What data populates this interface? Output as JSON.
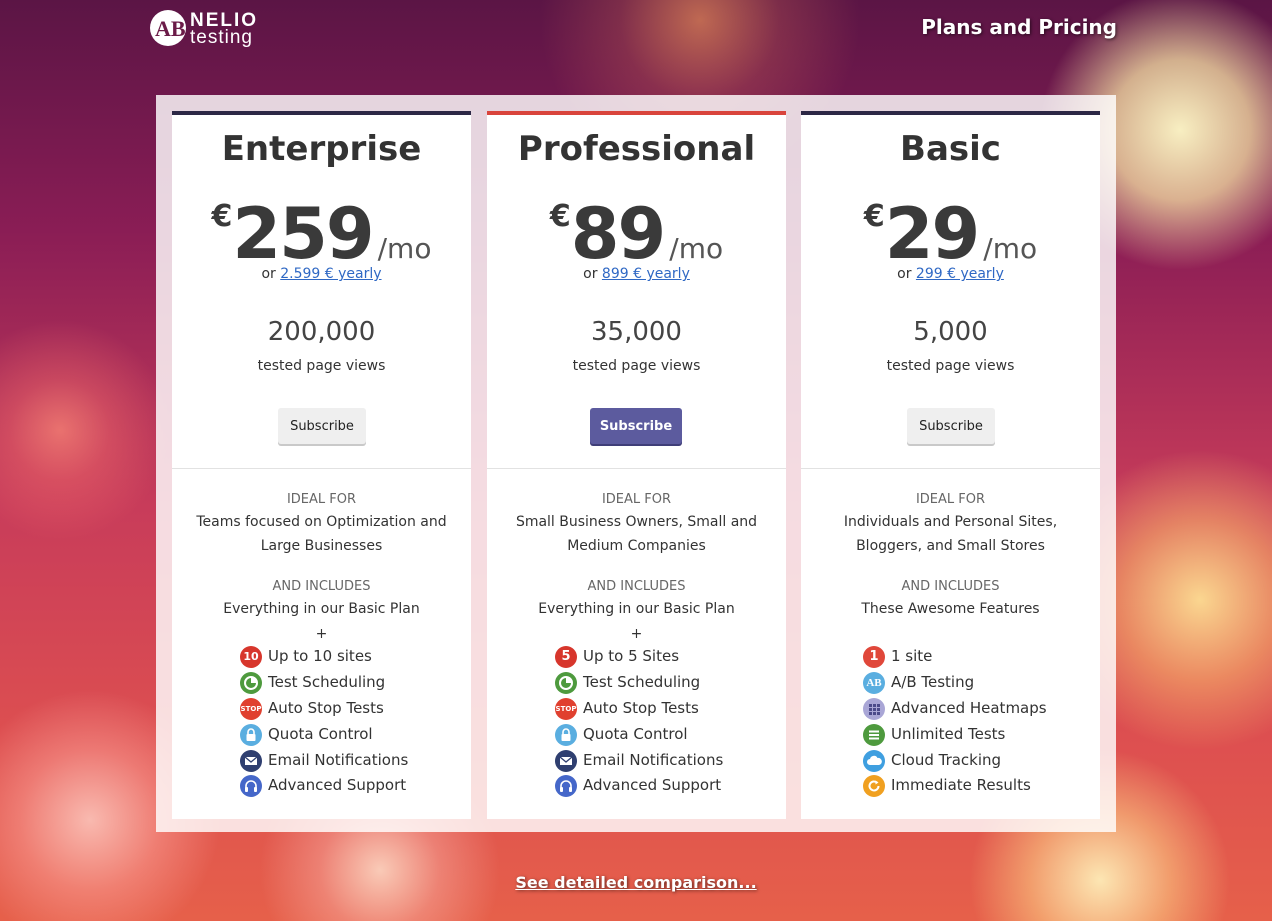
{
  "header": {
    "logo_top": "NELIO",
    "logo_bottom": "testing",
    "logo_mark": "AB",
    "title": "Plans and Pricing"
  },
  "plans": [
    {
      "name": "Enterprise",
      "currency": "€",
      "price": "259",
      "period": "/mo",
      "yearly_prefix": "or",
      "yearly_link": "2.599 € yearly",
      "views": "200,000",
      "views_label": "tested page views",
      "button": "Subscribe",
      "ideal_for_heading": "IDEAL FOR",
      "ideal_for": "Teams focused on Optimization and Large Businesses",
      "includes_heading": "AND INCLUDES",
      "includes": "Everything in our Basic Plan",
      "plus": "+",
      "features": [
        {
          "label": "Up to 10 sites",
          "icon": "number-10-icon",
          "badge": "10",
          "color": "#d7362c"
        },
        {
          "label": "Test Scheduling",
          "icon": "clock-icon",
          "badge": "",
          "color": "#4e9a3e"
        },
        {
          "label": "Auto Stop Tests",
          "icon": "stop-icon",
          "badge": "STOP",
          "color": "#e0402f"
        },
        {
          "label": "Quota Control",
          "icon": "lock-icon",
          "badge": "",
          "color": "#5aaee0"
        },
        {
          "label": "Email Notifications",
          "icon": "email-icon",
          "badge": "",
          "color": "#2f3f70"
        },
        {
          "label": "Advanced Support",
          "icon": "headphones-icon",
          "badge": "",
          "color": "#4567c9"
        }
      ]
    },
    {
      "name": "Professional",
      "currency": "€",
      "price": "89",
      "period": "/mo",
      "yearly_prefix": "or",
      "yearly_link": "899 € yearly",
      "views": "35,000",
      "views_label": "tested page views",
      "button": "Subscribe",
      "ideal_for_heading": "IDEAL FOR",
      "ideal_for": "Small Business Owners, Small and Medium Companies",
      "includes_heading": "AND INCLUDES",
      "includes": "Everything in our Basic Plan",
      "plus": "+",
      "features": [
        {
          "label": "Up to 5 Sites",
          "icon": "number-5-icon",
          "badge": "5",
          "color": "#d7362c"
        },
        {
          "label": "Test Scheduling",
          "icon": "clock-icon",
          "badge": "",
          "color": "#4e9a3e"
        },
        {
          "label": "Auto Stop Tests",
          "icon": "stop-icon",
          "badge": "STOP",
          "color": "#e0402f"
        },
        {
          "label": "Quota Control",
          "icon": "lock-icon",
          "badge": "",
          "color": "#5aaee0"
        },
        {
          "label": "Email Notifications",
          "icon": "email-icon",
          "badge": "",
          "color": "#2f3f70"
        },
        {
          "label": "Advanced Support",
          "icon": "headphones-icon",
          "badge": "",
          "color": "#4567c9"
        }
      ]
    },
    {
      "name": "Basic",
      "currency": "€",
      "price": "29",
      "period": "/mo",
      "yearly_prefix": "or",
      "yearly_link": "299 € yearly",
      "views": "5,000",
      "views_label": "tested page views",
      "button": "Subscribe",
      "ideal_for_heading": "IDEAL FOR",
      "ideal_for": "Individuals and Personal Sites, Bloggers, and Small Stores",
      "includes_heading": "AND INCLUDES",
      "includes": "These Awesome Features",
      "plus": "",
      "features": [
        {
          "label": "1 site",
          "icon": "number-1-icon",
          "badge": "1",
          "color": "#e0473a"
        },
        {
          "label": "A/B Testing",
          "icon": "ab-icon",
          "badge": "AB",
          "color": "#5aaee0"
        },
        {
          "label": "Advanced Heatmaps",
          "icon": "heatmap-icon",
          "badge": "",
          "color": "#a9a6d6"
        },
        {
          "label": "Unlimited Tests",
          "icon": "list-icon",
          "badge": "",
          "color": "#4e9a3e"
        },
        {
          "label": "Cloud Tracking",
          "icon": "cloud-icon",
          "badge": "",
          "color": "#3f9fe0"
        },
        {
          "label": "Immediate Results",
          "icon": "refresh-icon",
          "badge": "",
          "color": "#f0a020"
        }
      ]
    }
  ],
  "footer": {
    "comparison_link": "See detailed comparison..."
  }
}
